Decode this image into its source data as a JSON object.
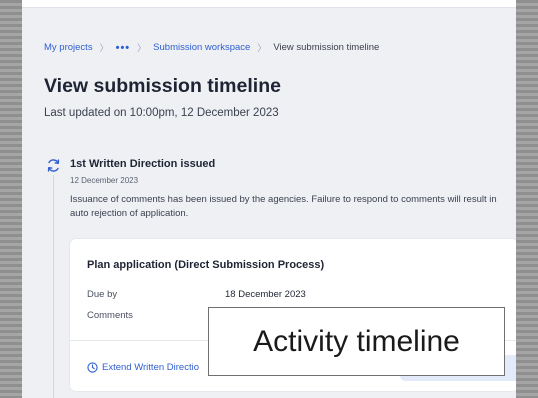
{
  "breadcrumb": {
    "items": [
      "My projects",
      "•••",
      "Submission workspace"
    ],
    "current": "View submission timeline",
    "separator": "〉"
  },
  "page": {
    "title": "View submission timeline",
    "updated": "Last updated on 10:00pm, 12 December 2023"
  },
  "event": {
    "icon": "refresh-icon",
    "title": "1st Written Direction issued",
    "date": "12 December 2023",
    "description": "Issuance of comments has been issued by the agencies. Failure to respond to comments will result in auto rejection of application."
  },
  "card": {
    "title": "Plan application (Direct Submission Process)",
    "rows": [
      {
        "label": "Due by",
        "value": "18 December 2023"
      },
      {
        "label": "Comments",
        "value": ""
      }
    ],
    "extend_label": "Extend Written Directio",
    "extend_icon": "clock-icon"
  },
  "overlay": {
    "caption": "Activity timeline"
  },
  "colors": {
    "accent": "#2f5fd0",
    "page_bg": "#eef0f4",
    "card_bg": "#ffffff"
  }
}
